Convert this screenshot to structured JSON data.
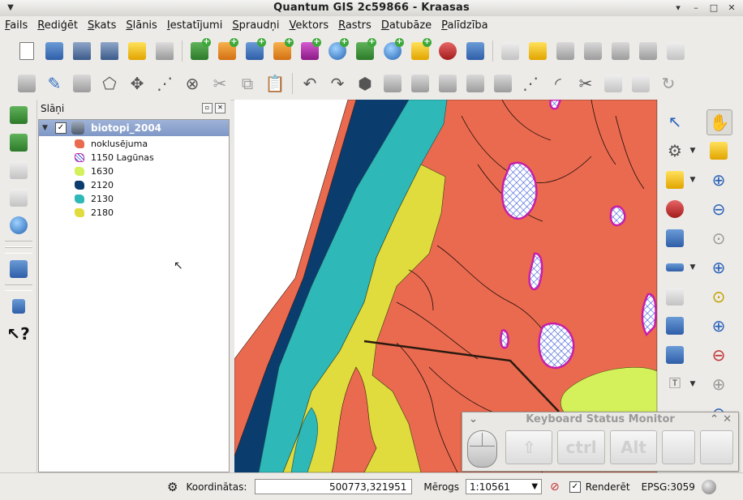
{
  "window": {
    "title": "Quantum GIS 2c59866 - Kraasas"
  },
  "menubar": [
    "Fails",
    "Rediģēt",
    "Skats",
    "Slānis",
    "Iestatījumi",
    "Spraudņi",
    "Vektors",
    "Rastrs",
    "Datubāze",
    "Palīdzība"
  ],
  "layers_panel": {
    "title": "Slāņi",
    "layer_name": "biotopi_2004",
    "legend": [
      {
        "label": "noklusējuma",
        "color": "#ea6a4f"
      },
      {
        "label": "1150 Lagūnas",
        "color": "#8a2be2"
      },
      {
        "label": "1630",
        "color": "#d4f05a"
      },
      {
        "label": "2120",
        "color": "#0a3c6e"
      },
      {
        "label": "2130",
        "color": "#2fb8b8"
      },
      {
        "label": "2180",
        "color": "#e0dc3e"
      }
    ]
  },
  "statusbar": {
    "coord_label": "Koordinātas:",
    "coord_value": "500773,321951",
    "scale_label": "Mērogs",
    "scale_value": "1:10561",
    "render_label": "Renderēt",
    "crs": "EPSG:3059"
  },
  "keyboard_monitor": {
    "title": "Keyboard Status Monitor",
    "keys": [
      "⇧",
      "ctrl",
      "Alt",
      "",
      ""
    ]
  }
}
